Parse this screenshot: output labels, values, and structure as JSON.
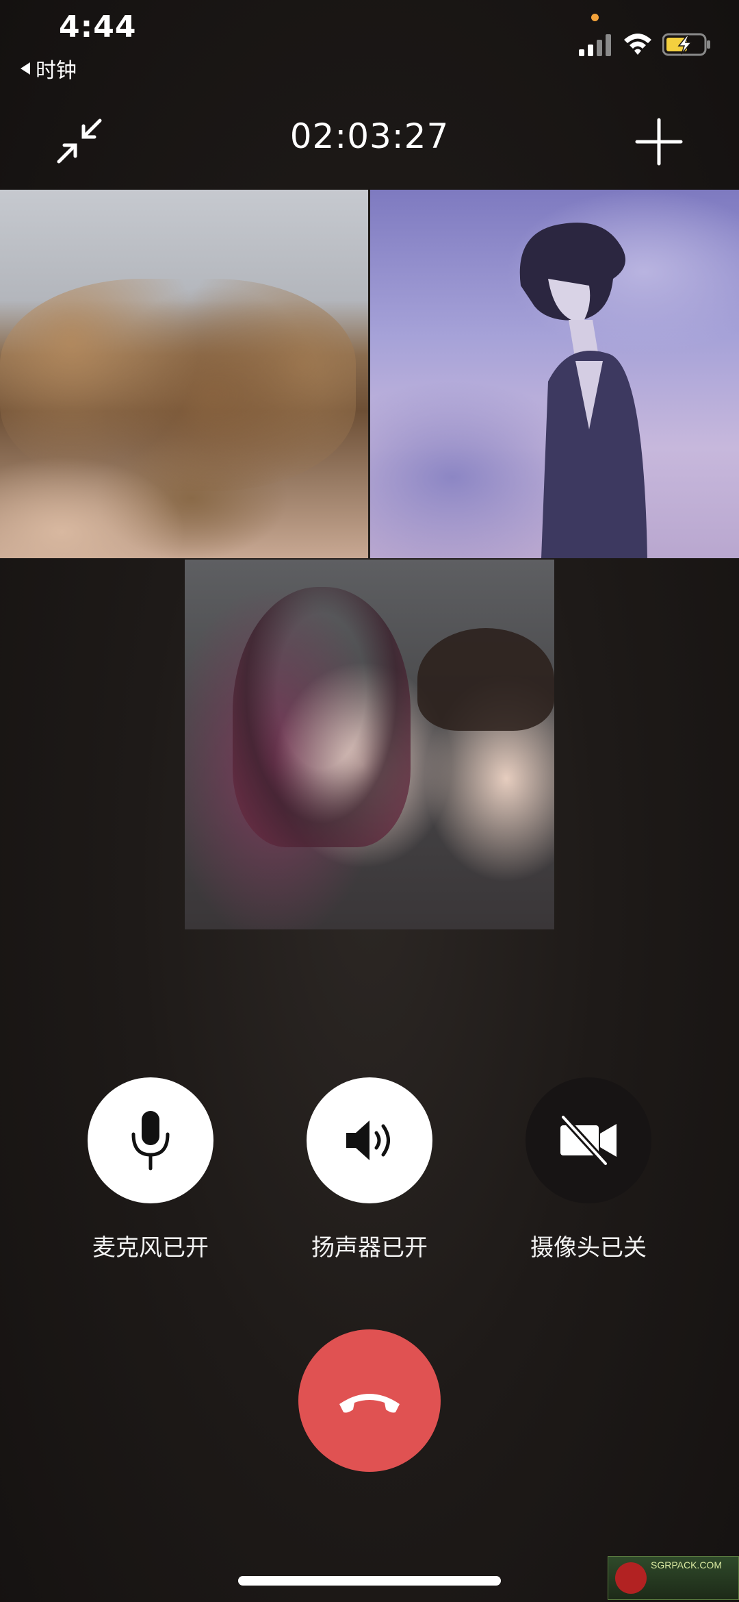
{
  "status_bar": {
    "time": "4:44",
    "back_app": "时钟",
    "icons": [
      "cellular-signal-icon",
      "wifi-icon",
      "battery-charging-icon"
    ],
    "privacy_indicator_color": "#f2a23a"
  },
  "top_bar": {
    "call_timer": "02:03:27",
    "left_icon": "minimize-arrows-icon",
    "right_icon": "plus-icon"
  },
  "video_tiles": [
    {
      "id": "participant-1"
    },
    {
      "id": "participant-2"
    },
    {
      "id": "participant-3"
    }
  ],
  "controls": {
    "mic": {
      "label": "麦克风已开",
      "icon": "microphone-icon",
      "state": "on"
    },
    "speaker": {
      "label": "扬声器已开",
      "icon": "speaker-icon",
      "state": "on"
    },
    "camera": {
      "label": "摄像头已关",
      "icon": "camera-off-icon",
      "state": "off"
    }
  },
  "hangup": {
    "icon": "phone-hangup-icon",
    "color": "#e05252"
  },
  "watermark": {
    "text": "SGRPACK.COM"
  }
}
